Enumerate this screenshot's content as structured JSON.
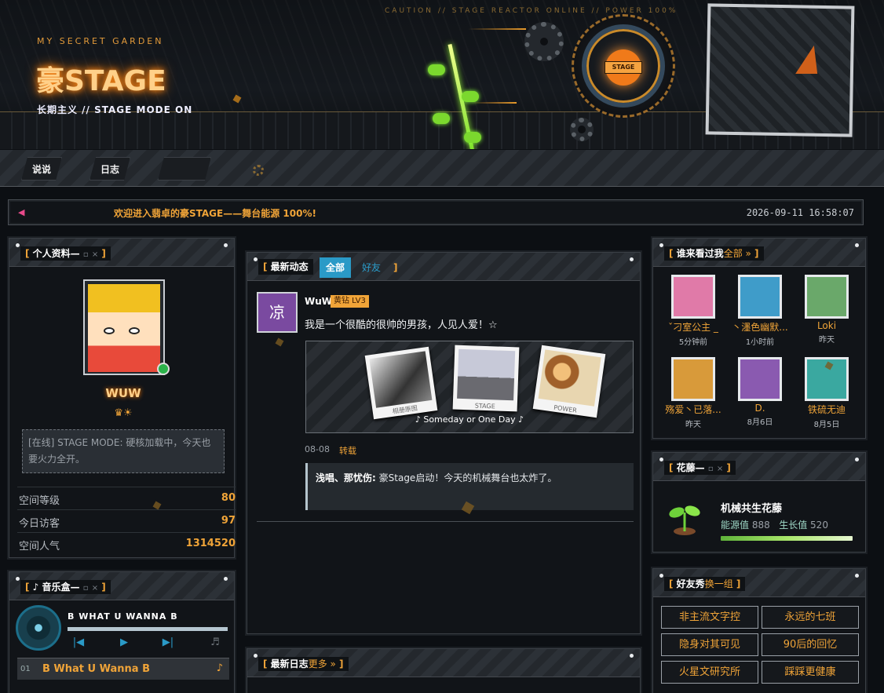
{
  "banner": {
    "tag": "MY SECRET GARDEN",
    "title": "豪STAGE",
    "subtitle": "长期主义 // STAGE MODE ON",
    "caution": "CAUTION // STAGE REACTOR ONLINE // POWER 100%",
    "reactor_label": "STAGE"
  },
  "nav": {
    "items": [
      "说说",
      "日志",
      ""
    ]
  },
  "marquee": {
    "message": "欢迎进入翡卓的豪STAGE——舞台能源 100%!",
    "time": "2026-09-11 16:58:07"
  },
  "profile": {
    "title": "个人资料—",
    "nickname": "WUW",
    "badges": "♛☀",
    "status": "[在线] STAGE MODE: 硬核加载中，今天也要火力全开。",
    "stats": [
      {
        "label": "空间等级",
        "value": "80"
      },
      {
        "label": "今日访客",
        "value": "97"
      },
      {
        "label": "空间人气",
        "value": "1314520"
      }
    ]
  },
  "music": {
    "title": "音乐盒—",
    "song": "B WHAT U WANNA B",
    "track_no": "01",
    "track_name": "B What U Wanna B",
    "note": "♪",
    "note2": "♬"
  },
  "feed": {
    "title": "最新动态",
    "tab_all": "全部",
    "tab_friends": "好友",
    "post": {
      "avatar_char": "凉",
      "user": "WuW",
      "vip": "黄钻 LV3",
      "text": "我是一个很酷的很帅的男孩，人见人爱！☆",
      "photos": [
        {
          "caption": "相册原图"
        },
        {
          "caption": "STAGE"
        },
        {
          "caption": "POWER"
        }
      ],
      "music_caption": "♪   Someday or One Day   ♪",
      "date": "08-08",
      "repost": "转载",
      "comment_user": "浅唱、那忧伤:",
      "comment_text": "豪Stage启动！今天的机械舞台也太炸了。"
    }
  },
  "blog": {
    "title": "最新日志",
    "more": "更多 »"
  },
  "visitors": {
    "title": "谁来看过我",
    "link": "全部 »",
    "items": [
      {
        "name": "ˇ刁室公主 _",
        "time": "5分钟前",
        "color": "#e07aa8"
      },
      {
        "name": "丶濹色幽默...",
        "time": "1小时前",
        "color": "#3f9cc9"
      },
      {
        "name": "Loki",
        "time": "昨天",
        "color": "#6aa86a"
      },
      {
        "name": "殇爱丶已落...",
        "time": "昨天",
        "color": "#d89a3a"
      },
      {
        "name": "D.",
        "time": "8月6日",
        "color": "#8a5ab0"
      },
      {
        "name": "铁硫无迪",
        "time": "8月5日",
        "color": "#3aa8a0"
      }
    ]
  },
  "vine": {
    "title": "花藤—",
    "name": "机械共生花藤",
    "energy_label": "能源值",
    "energy": "888",
    "growth_label": "生长值",
    "growth": "520"
  },
  "friends": {
    "title": "好友秀",
    "link": "换一组",
    "tags": [
      "非主流文字控",
      "永远的七班",
      "隐身对其可见",
      "90后的回忆",
      "火星文研究所",
      "踩踩更健康"
    ]
  },
  "colors": {
    "accent": "#f0a438",
    "background": "#0c0f13",
    "blue_tab": "#2a9ac7"
  }
}
